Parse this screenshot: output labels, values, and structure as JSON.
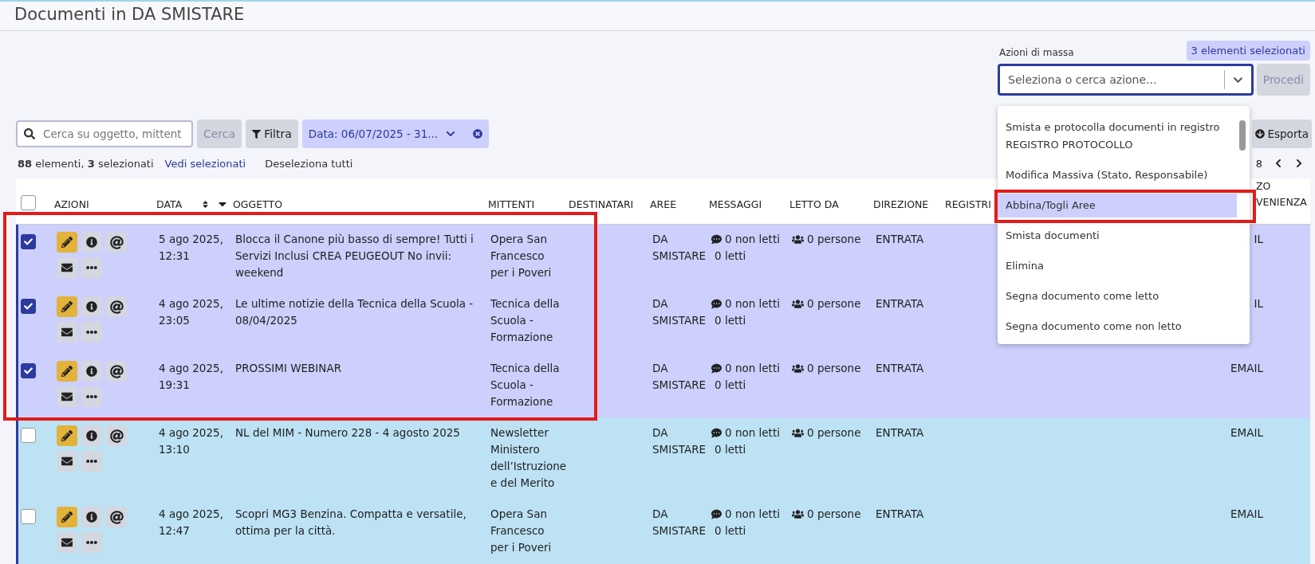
{
  "page": {
    "title": "Documenti in DA SMISTARE"
  },
  "bulk_actions": {
    "label": "Azioni di massa",
    "selection_badge": "3 elementi selezionati",
    "placeholder": "Seleziona o cerca azione...",
    "proceed_button": {
      "label": "Procedi",
      "disabled": true
    },
    "options": [
      {
        "label": "Smista e protocolla documenti in registro REGISTRO PROTOCOLLO",
        "selected": false
      },
      {
        "label": "Modifica Massiva (Stato, Responsabile)",
        "selected": false
      },
      {
        "label": "Abbina/Togli Aree",
        "selected": true
      },
      {
        "label": "Smista documenti",
        "selected": false
      },
      {
        "label": "Elimina",
        "selected": false
      },
      {
        "label": "Segna documento come letto",
        "selected": false
      },
      {
        "label": "Segna documento come non letto",
        "selected": false
      }
    ]
  },
  "toolbar": {
    "search": {
      "placeholder": "Cerca su oggetto, mittent"
    },
    "search_button": {
      "label": "Cerca",
      "disabled": true
    },
    "filter_button": "Filtra",
    "date_filter": "Data: 06/07/2025 - 31...",
    "export_button": "Esporta"
  },
  "summary": {
    "text": "**88** elementi, **3** selezionati",
    "view_selected": "Vedi selezionati",
    "deselect_all": "Deseleziona tutti",
    "pagination": "8"
  },
  "table": {
    "select_all": {
      "checked": false
    },
    "columns": [
      "AZIONI",
      "DATA",
      "OGGETTO",
      "MITTENTI",
      "DESTINATARI",
      "AREE",
      "MESSAGGI",
      "LETTO DA",
      "DIREZIONE",
      "REGISTRI",
      "ZO VENIENZA"
    ],
    "rows": [
      {
        "selected": true,
        "date": "5 ago 2025, 12:31",
        "subject": "Blocca il Canone più basso di sempre! Tutti i Servizi Inclusi CREA PEUGEOUT No invii: weekend",
        "senders": "Opera San Francesco per i Poveri",
        "areas": "DA SMISTARE",
        "unread": "0 non letti",
        "read": "0 letti",
        "read_by": "0 persone",
        "direction": "ENTRATA",
        "source": "IL"
      },
      {
        "selected": true,
        "date": "4 ago 2025, 23:05",
        "subject": "Le ultime notizie della Tecnica della Scuola - 08/04/2025",
        "senders": "Tecnica della Scuola - Formazione",
        "areas": "DA SMISTARE",
        "unread": "0 non letti",
        "read": "0 letti",
        "read_by": "0 persone",
        "direction": "ENTRATA",
        "source": "IL"
      },
      {
        "selected": true,
        "date": "4 ago 2025, 19:31",
        "subject": "PROSSIMI WEBINAR",
        "senders": "Tecnica della Scuola - Formazione",
        "areas": "DA SMISTARE",
        "unread": "0 non letti",
        "read": "0 letti",
        "read_by": "0 persone",
        "direction": "ENTRATA",
        "source": "EMAIL"
      },
      {
        "selected": false,
        "date": "4 ago 2025, 13:10",
        "subject": "NL del MIM - Numero 228 - 4 agosto 2025",
        "senders": "Newsletter Ministero dell’Istruzione e del Merito",
        "areas": "DA SMISTARE",
        "unread": "0 non letti",
        "read": "0 letti",
        "read_by": "0 persone",
        "direction": "ENTRATA",
        "source": "EMAIL"
      },
      {
        "selected": false,
        "date": "4 ago 2025, 12:47",
        "subject": "Scopri MG3 Benzina. Compatta e versatile, ottima per la città.",
        "senders": "Opera San Francesco per i Poveri",
        "areas": "DA SMISTARE",
        "unread": "0 non letti",
        "read": "0 letti",
        "read_by": "0 persone",
        "direction": "ENTRATA",
        "source": "EMAIL"
      }
    ]
  }
}
